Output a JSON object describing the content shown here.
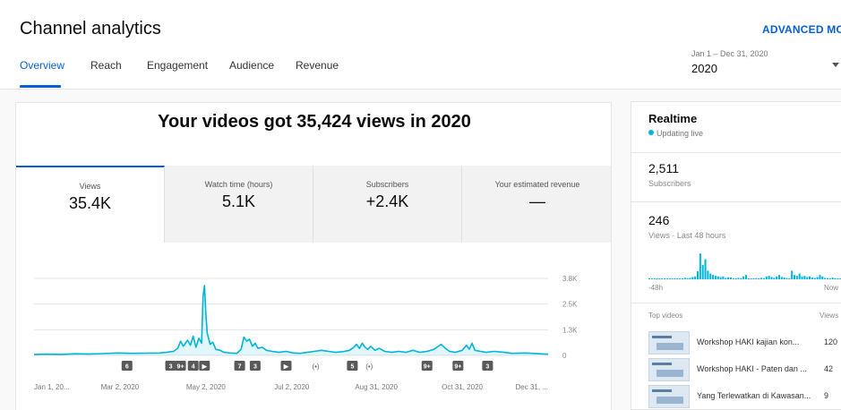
{
  "app": {
    "title": "Channel analytics",
    "advanced_mode": "ADVANCED MODE"
  },
  "tabs": [
    "Overview",
    "Reach",
    "Engagement",
    "Audience",
    "Revenue"
  ],
  "date_picker": {
    "range": "Jan 1 – Dec 31, 2020",
    "year": "2020",
    "caret_icon": "caret-down-icon"
  },
  "headline": "Your videos got 35,424 views in 2020",
  "metrics": [
    {
      "label": "Views",
      "value": "35.4K"
    },
    {
      "label": "Watch time (hours)",
      "value": "5.1K"
    },
    {
      "label": "Subscribers",
      "value": "+2.4K"
    },
    {
      "label": "Your estimated revenue",
      "value": "—"
    }
  ],
  "chart_data": {
    "type": "area",
    "ylim": [
      0,
      3.8
    ],
    "y_ticks": [
      "0",
      "1.3K",
      "2.5K",
      "3.8K"
    ],
    "y_tick_values": [
      0,
      1.267,
      2.533,
      3.8
    ],
    "x_tick_labels": [
      "Jan 1, 20...",
      "Mar 2, 2020",
      "May 2, 2020",
      "Jul 2, 2020",
      "Aug 31, 2020",
      "Oct 31, 2020",
      "Dec 31, ..."
    ],
    "x_tick_days": [
      1,
      62,
      123,
      184,
      244,
      305,
      366
    ],
    "days_in_range": 366,
    "color": "#00b5d8",
    "series": [
      {
        "points": [
          [
            1,
            0.05
          ],
          [
            10,
            0.06
          ],
          [
            20,
            0.05
          ],
          [
            30,
            0.08
          ],
          [
            40,
            0.07
          ],
          [
            50,
            0.09
          ],
          [
            60,
            0.12
          ],
          [
            70,
            0.1
          ],
          [
            80,
            0.11
          ],
          [
            90,
            0.12
          ],
          [
            95,
            0.15
          ],
          [
            100,
            0.2
          ],
          [
            103,
            0.35
          ],
          [
            105,
            0.7
          ],
          [
            107,
            0.45
          ],
          [
            110,
            0.75
          ],
          [
            112,
            0.5
          ],
          [
            114,
            0.95
          ],
          [
            116,
            0.4
          ],
          [
            118,
            0.85
          ],
          [
            120,
            0.6
          ],
          [
            121,
            2.9
          ],
          [
            122,
            3.45
          ],
          [
            123,
            2.0
          ],
          [
            124,
            1.1
          ],
          [
            126,
            0.55
          ],
          [
            128,
            0.65
          ],
          [
            130,
            0.3
          ],
          [
            133,
            0.25
          ],
          [
            136,
            0.15
          ],
          [
            140,
            0.12
          ],
          [
            145,
            0.1
          ],
          [
            148,
            0.3
          ],
          [
            150,
            0.9
          ],
          [
            152,
            0.7
          ],
          [
            154,
            0.8
          ],
          [
            156,
            0.45
          ],
          [
            158,
            0.6
          ],
          [
            160,
            0.35
          ],
          [
            163,
            0.4
          ],
          [
            166,
            0.25
          ],
          [
            170,
            0.2
          ],
          [
            175,
            0.15
          ],
          [
            180,
            0.2
          ],
          [
            185,
            0.12
          ],
          [
            190,
            0.1
          ],
          [
            195,
            0.15
          ],
          [
            200,
            0.2
          ],
          [
            205,
            0.25
          ],
          [
            210,
            0.2
          ],
          [
            215,
            0.15
          ],
          [
            220,
            0.18
          ],
          [
            225,
            0.25
          ],
          [
            228,
            0.4
          ],
          [
            230,
            0.55
          ],
          [
            232,
            0.35
          ],
          [
            234,
            0.6
          ],
          [
            236,
            0.4
          ],
          [
            238,
            0.3
          ],
          [
            240,
            0.45
          ],
          [
            243,
            0.25
          ],
          [
            246,
            0.35
          ],
          [
            250,
            0.2
          ],
          [
            255,
            0.15
          ],
          [
            260,
            0.2
          ],
          [
            265,
            0.15
          ],
          [
            270,
            0.25
          ],
          [
            275,
            0.15
          ],
          [
            280,
            0.2
          ],
          [
            285,
            0.3
          ],
          [
            290,
            0.55
          ],
          [
            293,
            0.35
          ],
          [
            296,
            0.2
          ],
          [
            300,
            0.15
          ],
          [
            305,
            0.25
          ],
          [
            308,
            0.5
          ],
          [
            310,
            0.3
          ],
          [
            312,
            0.6
          ],
          [
            314,
            0.25
          ],
          [
            318,
            0.2
          ],
          [
            322,
            0.15
          ],
          [
            328,
            0.2
          ],
          [
            335,
            0.15
          ],
          [
            340,
            0.1
          ],
          [
            350,
            0.12
          ],
          [
            360,
            0.08
          ],
          [
            366,
            0.06
          ]
        ]
      }
    ],
    "markers": [
      {
        "day": 67,
        "label": "6"
      },
      {
        "day": 98,
        "label": "3"
      },
      {
        "day": 105,
        "label": "9+"
      },
      {
        "day": 114,
        "label": "4"
      },
      {
        "day": 122,
        "label": "▶"
      },
      {
        "day": 147,
        "label": "7"
      },
      {
        "day": 158,
        "label": "3"
      },
      {
        "day": 180,
        "label": "▶"
      },
      {
        "day": 201,
        "label": "(•)",
        "plain": true
      },
      {
        "day": 227,
        "label": "5"
      },
      {
        "day": 239,
        "label": "(•)",
        "plain": true
      },
      {
        "day": 280,
        "label": "9+"
      },
      {
        "day": 302,
        "label": "9+"
      },
      {
        "day": 323,
        "label": "3"
      }
    ]
  },
  "realtime": {
    "title": "Realtime",
    "status": "Updating live",
    "subscribers_value": "2,511",
    "subscribers_label": "Subscribers",
    "views_value": "246",
    "views_label": "Views · Last 48 hours",
    "left_label": "-48h",
    "right_label": "Now",
    "bars": [
      0,
      0,
      0,
      0,
      0,
      0,
      0,
      0,
      0,
      0,
      0,
      0,
      0.02,
      0.02,
      0.05,
      0.04,
      0.05,
      0.08,
      0.1,
      0.28,
      0.9,
      0.5,
      0.7,
      0.3,
      0.2,
      0.15,
      0.12,
      0.1,
      0.08,
      0.1,
      0.05,
      0.07,
      0.06,
      0.02,
      0.03,
      0.05,
      0.04,
      0.1,
      0.15,
      0.03,
      0.03,
      0.02,
      0.04,
      0.03,
      0.05,
      0.04,
      0.1,
      0.12,
      0.08,
      0.05,
      0.1,
      0.15,
      0.08,
      0.06,
      0.04,
      0.03,
      0.3,
      0.15,
      0.12,
      0.2,
      0.1,
      0.12,
      0.08,
      0.1,
      0.06,
      0.05,
      0.08,
      0.15,
      0.1,
      0.05,
      0.04,
      0.03,
      0.06,
      0.04,
      0.03,
      0.02
    ],
    "top_videos_label": "Top videos",
    "views_col_label": "Views",
    "videos": [
      {
        "title": "Workshop HAKI kajian kon...",
        "views": "120"
      },
      {
        "title": "Workshop HAKI - Paten dan ...",
        "views": "42"
      },
      {
        "title": "Yang Terlewatkan di Kawasan...",
        "views": "9"
      }
    ]
  }
}
